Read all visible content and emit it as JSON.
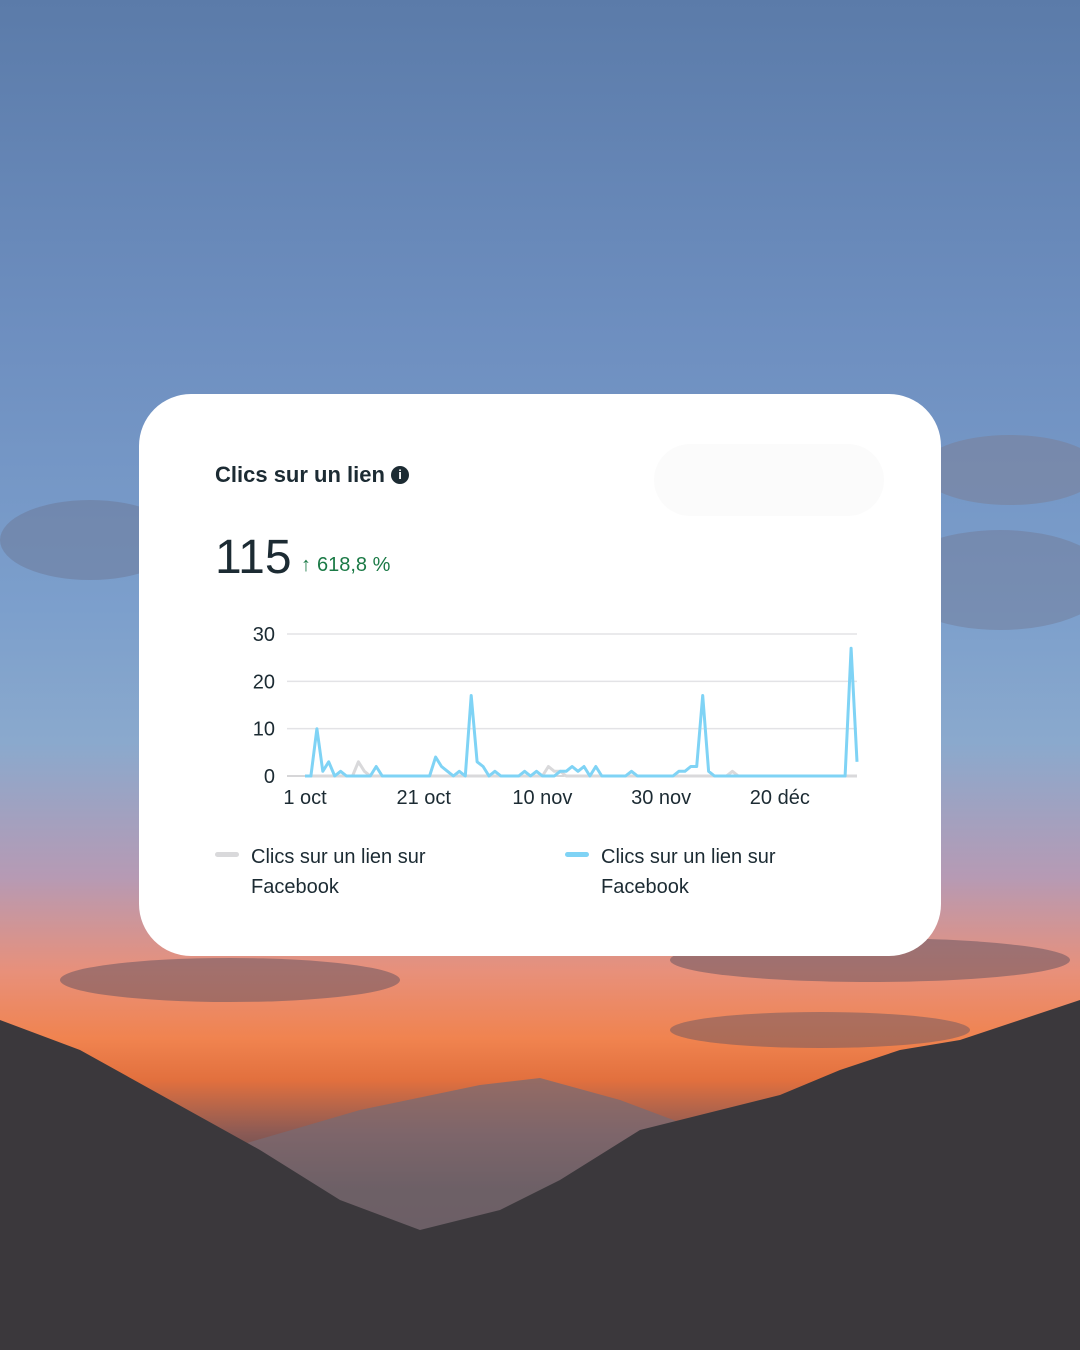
{
  "card": {
    "title": "Clics sur un lien",
    "info_icon": "info-icon",
    "total": "115",
    "change": "618,8 %",
    "change_arrow": "↑",
    "change_color": "#1b7a46"
  },
  "chart_data": {
    "type": "line",
    "title": "",
    "xlabel": "",
    "ylabel": "",
    "ylim": [
      0,
      30
    ],
    "yticks": [
      "0",
      "10",
      "20",
      "30"
    ],
    "xtick_labels": [
      "1 oct",
      "21 oct",
      "10 nov",
      "30 nov",
      "20 déc"
    ],
    "xtick_day_index": [
      0,
      20,
      40,
      60,
      80
    ],
    "grid": true,
    "legend_position": "bottom",
    "series": [
      {
        "name": "Clics sur un lien sur Facebook",
        "color": "#d9d9db",
        "values": [
          0,
          0,
          0,
          0,
          0,
          0,
          0,
          0,
          0,
          3,
          1,
          0,
          0,
          0,
          0,
          0,
          0,
          0,
          0,
          0,
          0,
          0,
          0,
          0,
          0,
          0,
          0,
          0,
          0,
          0,
          0,
          0,
          0,
          0,
          0,
          0,
          0,
          0,
          0,
          0,
          0,
          2,
          1,
          1,
          0,
          0,
          0,
          0,
          0,
          0,
          0,
          0,
          0,
          0,
          0,
          0,
          0,
          0,
          0,
          0,
          0,
          0,
          0,
          0,
          0,
          0,
          0,
          0,
          0,
          0,
          0,
          0,
          1,
          0,
          0,
          0,
          0,
          0,
          0,
          0,
          0,
          0,
          0,
          0,
          0,
          0,
          0,
          0,
          0,
          0,
          0,
          0,
          0,
          0
        ]
      },
      {
        "name": "Clics sur un lien sur Facebook",
        "color": "#7fd3f5",
        "values": [
          0,
          0,
          10,
          1,
          3,
          0,
          1,
          0,
          0,
          0,
          0,
          0,
          2,
          0,
          0,
          0,
          0,
          0,
          0,
          0,
          0,
          0,
          4,
          2,
          1,
          0,
          1,
          0,
          17,
          3,
          2,
          0,
          1,
          0,
          0,
          0,
          0,
          1,
          0,
          1,
          0,
          0,
          0,
          1,
          1,
          2,
          1,
          2,
          0,
          2,
          0,
          0,
          0,
          0,
          0,
          1,
          0,
          0,
          0,
          0,
          0,
          0,
          0,
          1,
          1,
          2,
          2,
          17,
          1,
          0,
          0,
          0,
          0,
          0,
          0,
          0,
          0,
          0,
          0,
          0,
          0,
          0,
          0,
          0,
          0,
          0,
          0,
          0,
          0,
          0,
          0,
          0,
          27,
          3
        ]
      }
    ]
  }
}
